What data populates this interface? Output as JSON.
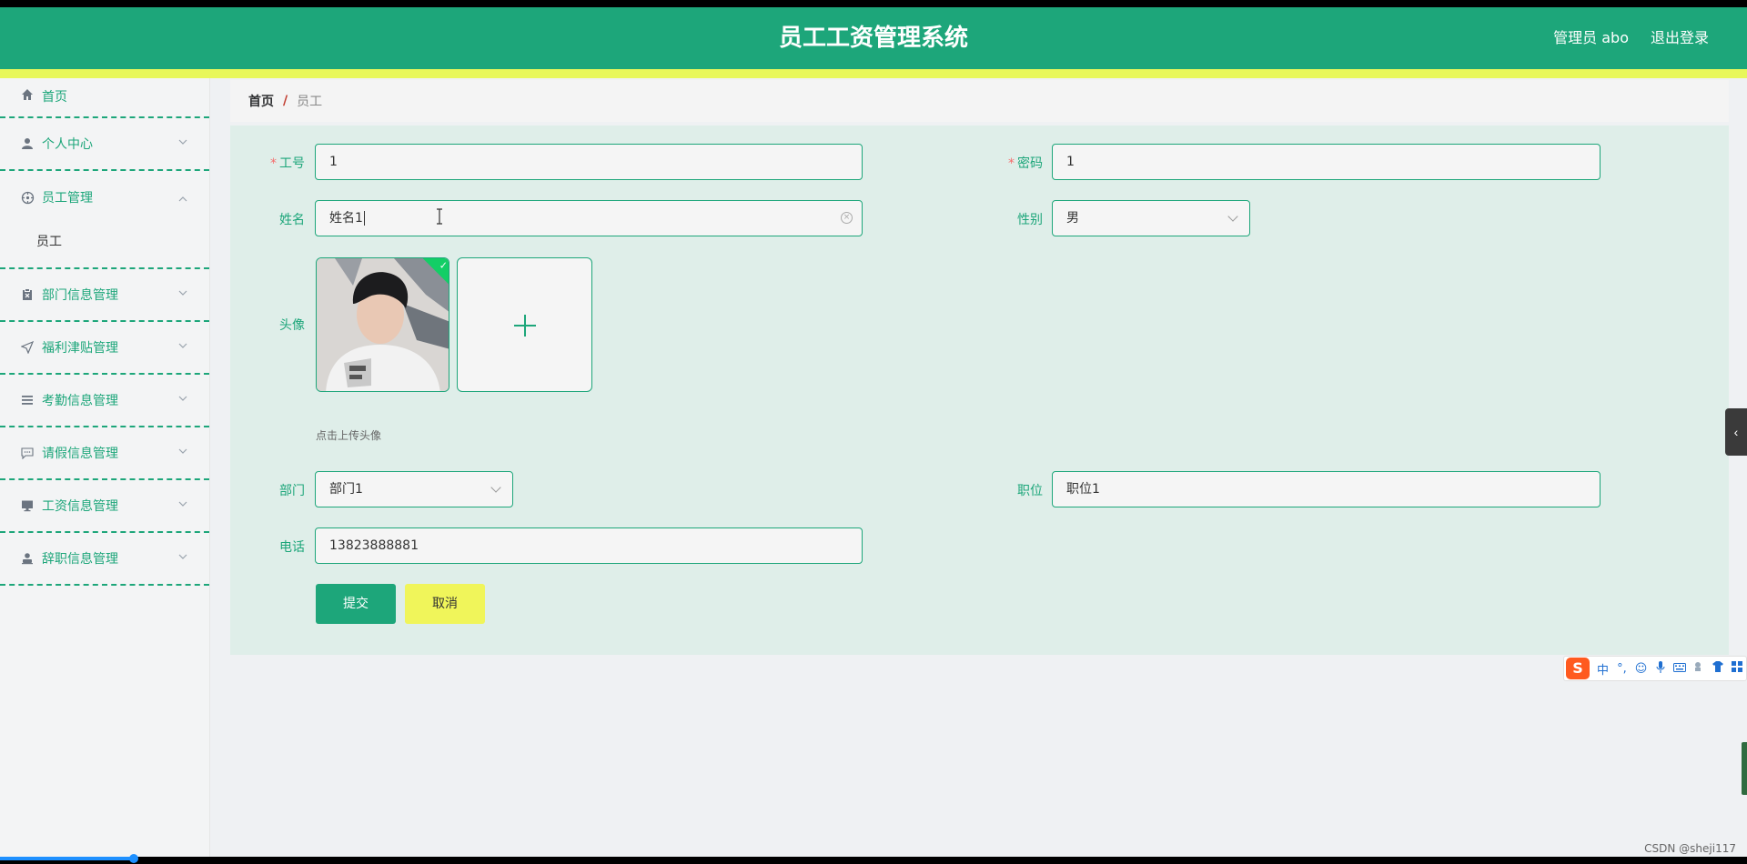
{
  "header": {
    "title": "员工工资管理系统",
    "user": "管理员 abo",
    "logout": "退出登录"
  },
  "sidebar": {
    "items": [
      {
        "label": "首页",
        "icon": "home-icon"
      },
      {
        "label": "个人中心",
        "icon": "user-icon"
      },
      {
        "label": "员工管理",
        "icon": "compass-icon",
        "expanded": true,
        "children": [
          {
            "label": "员工"
          }
        ]
      },
      {
        "label": "部门信息管理",
        "icon": "clipboard-icon"
      },
      {
        "label": "福利津贴管理",
        "icon": "send-icon"
      },
      {
        "label": "考勤信息管理",
        "icon": "list-icon"
      },
      {
        "label": "请假信息管理",
        "icon": "chat-icon"
      },
      {
        "label": "工资信息管理",
        "icon": "monitor-icon"
      },
      {
        "label": "辞职信息管理",
        "icon": "person-icon"
      }
    ]
  },
  "breadcrumb": {
    "home": "首页",
    "separator": "/",
    "current": "员工"
  },
  "form": {
    "gonghao": {
      "label": "工号",
      "required": true,
      "value": "1"
    },
    "mima": {
      "label": "密码",
      "required": true,
      "value": "1"
    },
    "xingming": {
      "label": "姓名",
      "value": "姓名1"
    },
    "xingbie": {
      "label": "性别",
      "value": "男"
    },
    "touxiang": {
      "label": "头像",
      "tip": "点击上传头像"
    },
    "bumen": {
      "label": "部门",
      "value": "部门1"
    },
    "zhiwei": {
      "label": "职位",
      "value": "职位1"
    },
    "dianhua": {
      "label": "电话",
      "value": "13823888881"
    },
    "submit_label": "提交",
    "cancel_label": "取消"
  },
  "ime": {
    "logo": "S",
    "mode": "中",
    "buttons": [
      "punctuation-icon",
      "emoji-icon",
      "microphone-icon",
      "keyboard-icon",
      "tools-icon",
      "skin-icon",
      "grid-icon"
    ]
  },
  "watermark": "CSDN @sheji117",
  "colors": {
    "primary": "#1da67a",
    "accent_yellow": "#e8f75a",
    "cancel_yellow": "#f0f55a",
    "form_bg": "#dfeee9",
    "required": "#f56c6c"
  }
}
